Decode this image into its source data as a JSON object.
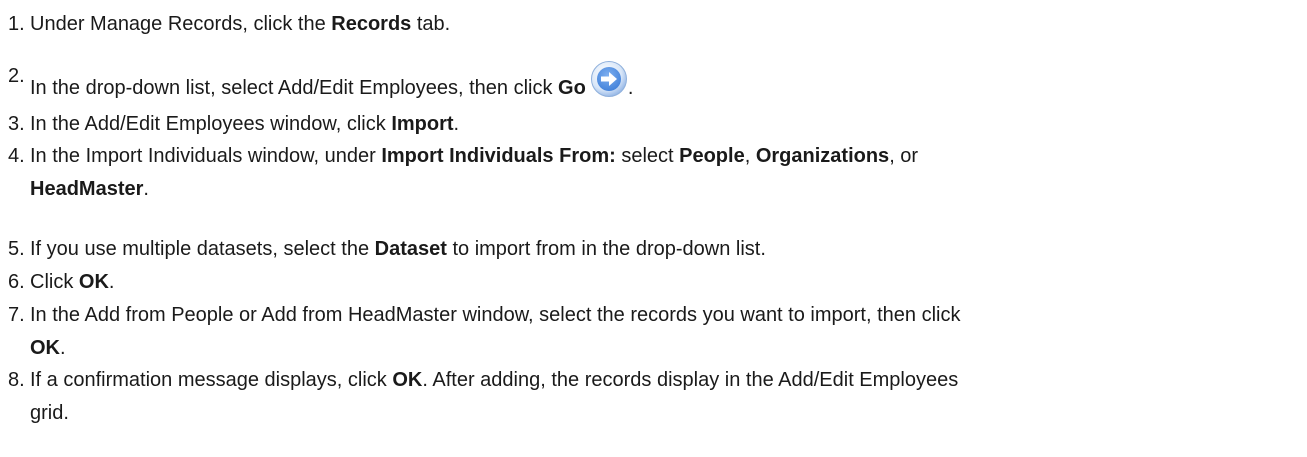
{
  "steps": [
    {
      "n": "1.",
      "parts": [
        {
          "t": "Under Manage Records, click the "
        },
        {
          "t": "Records",
          "b": true
        },
        {
          "t": " tab."
        }
      ]
    },
    {
      "n": "2.",
      "parts": [
        {
          "t": "In the drop-down list, select Add/Edit Employees, then click "
        },
        {
          "t": "Go",
          "b": true
        },
        {
          "icon": "go-arrow-icon"
        },
        {
          "t": "."
        }
      ]
    },
    {
      "n": "3.",
      "parts": [
        {
          "t": "In the Add/Edit Employees window, click "
        },
        {
          "t": "Import",
          "b": true
        },
        {
          "t": "."
        }
      ]
    },
    {
      "n": "4.",
      "parts": [
        {
          "t": "In the Import Individuals window, under "
        },
        {
          "t": "Import Individuals From:",
          "b": true
        },
        {
          "t": " select "
        },
        {
          "t": "People",
          "b": true
        },
        {
          "t": ", "
        },
        {
          "t": "Organizations",
          "b": true
        },
        {
          "t": ", or"
        },
        {
          "br": true
        },
        {
          "t": "HeadMaster",
          "b": true
        },
        {
          "t": "."
        }
      ]
    },
    {
      "n": "5.",
      "parts": [
        {
          "t": "If you use multiple datasets, select the "
        },
        {
          "t": "Dataset",
          "b": true
        },
        {
          "t": " to import from in the drop-down list."
        }
      ]
    },
    {
      "n": "6.",
      "parts": [
        {
          "t": "Click "
        },
        {
          "t": "OK",
          "b": true
        },
        {
          "t": "."
        }
      ]
    },
    {
      "n": "7.",
      "parts": [
        {
          "t": "In the Add from People or Add from HeadMaster window, select the records you want to import, then click"
        },
        {
          "br": true
        },
        {
          "t": "OK",
          "b": true
        },
        {
          "t": "."
        }
      ]
    },
    {
      "n": "8.",
      "parts": [
        {
          "t": "If a confirmation message displays, click "
        },
        {
          "t": "OK",
          "b": true
        },
        {
          "t": ". After adding, the records display in the Add/Edit Employees"
        },
        {
          "br": true
        },
        {
          "t": "grid."
        }
      ]
    }
  ],
  "colors": {
    "text": "#1a1a1a",
    "icon_blue": "#3f7fd9",
    "icon_ring": "#aac6ef"
  }
}
